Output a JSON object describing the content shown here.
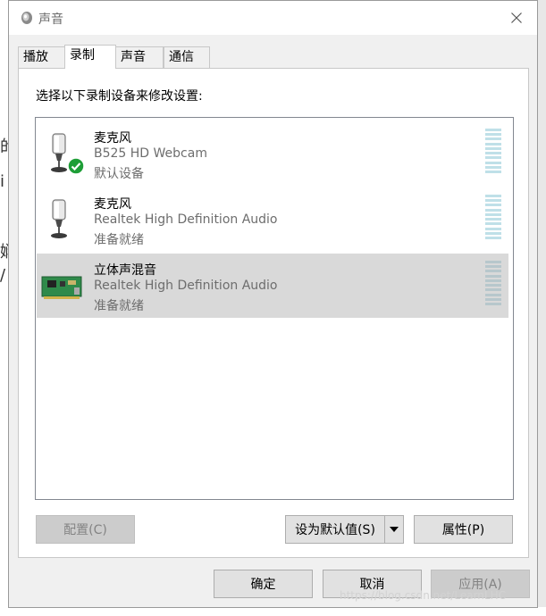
{
  "window": {
    "title": "声音",
    "icon": "speaker-icon",
    "close_icon": "close-icon"
  },
  "tabs": [
    {
      "label": "播放",
      "active": false
    },
    {
      "label": "录制",
      "active": true
    },
    {
      "label": "声音",
      "active": false
    },
    {
      "label": "通信",
      "active": false
    }
  ],
  "panel": {
    "instruction": "选择以下录制设备来修改设置:"
  },
  "devices": [
    {
      "name": "麦克风",
      "description": "B525 HD Webcam",
      "status": "默认设备",
      "icon": "microphone-icon",
      "badge": "default-check-icon",
      "selected": false
    },
    {
      "name": "麦克风",
      "description": "Realtek High Definition Audio",
      "status": "准备就绪",
      "icon": "microphone-icon",
      "selected": false
    },
    {
      "name": "立体声混音",
      "description": "Realtek High Definition Audio",
      "status": "准备就绪",
      "icon": "sound-card-icon",
      "selected": true
    }
  ],
  "panel_buttons": {
    "configure": "配置(C)",
    "set_default": "设为默认值(S)",
    "properties": "属性(P)"
  },
  "dialog_buttons": {
    "ok": "确定",
    "cancel": "取消",
    "apply": "应用(A)"
  },
  "watermark": "https://blog.csdn.net/LearnLHC",
  "colors": {
    "selected_row": "#d9d9d9",
    "meter": "#bfe0e8",
    "check_badge": "#1e9e37"
  }
}
